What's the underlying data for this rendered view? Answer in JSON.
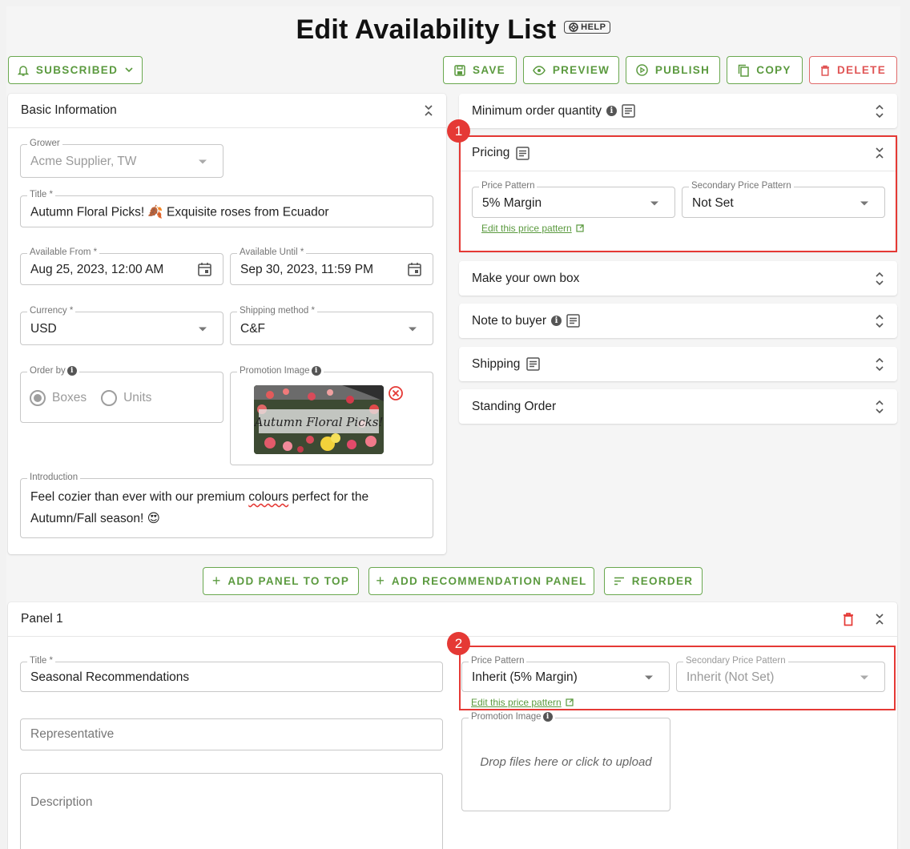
{
  "header": {
    "title": "Edit Availability List",
    "help_label": "HELP"
  },
  "toolbar": {
    "subscribed_label": "SUBSCRIBED",
    "save_label": "SAVE",
    "preview_label": "PREVIEW",
    "publish_label": "PUBLISH",
    "copy_label": "COPY",
    "delete_label": "DELETE"
  },
  "basic_info": {
    "heading": "Basic Information",
    "grower": {
      "label": "Grower",
      "value": "Acme Supplier, TW"
    },
    "title": {
      "label": "Title *",
      "value": "Autumn Floral Picks! 🍂 Exquisite roses from Ecuador"
    },
    "available_from": {
      "label": "Available From *",
      "value": "Aug 25, 2023, 12:00 AM"
    },
    "available_until": {
      "label": "Available Until *",
      "value": "Sep 30, 2023, 11:59 PM"
    },
    "currency": {
      "label": "Currency *",
      "value": "USD"
    },
    "shipping_method": {
      "label": "Shipping method *",
      "value": "C&F"
    },
    "order_by": {
      "label": "Order by",
      "options": [
        "Boxes",
        "Units"
      ],
      "selected": "Boxes"
    },
    "promotion_image": {
      "label": "Promotion Image",
      "image_text": "Autumn Floral Picks!"
    },
    "introduction": {
      "label": "Introduction",
      "line1_pre": "Feel cozier than ever with our premium ",
      "line1_word": "colours",
      "line1_post": " perfect for the",
      "line2": "Autumn/Fall season! 😍"
    }
  },
  "right_panels": {
    "min_order": "Minimum order quantity",
    "pricing": {
      "heading": "Pricing",
      "price_pattern": {
        "label": "Price Pattern",
        "value": "5% Margin"
      },
      "secondary": {
        "label": "Secondary Price Pattern",
        "value": "Not Set"
      },
      "edit_link": "Edit this price pattern"
    },
    "make_box": "Make your own box",
    "note_buyer": "Note to buyer",
    "shipping": "Shipping",
    "standing_order": "Standing Order"
  },
  "annotations": {
    "badge1": "1",
    "badge2": "2"
  },
  "panel_actions": {
    "add_top": "ADD PANEL TO TOP",
    "add_recommendation": "ADD RECOMMENDATION PANEL",
    "reorder": "REORDER"
  },
  "panel1": {
    "heading": "Panel 1",
    "title": {
      "label": "Title *",
      "value": "Seasonal Recommendations"
    },
    "representative_placeholder": "Representative",
    "description_placeholder": "Description",
    "price_pattern": {
      "label": "Price Pattern",
      "value": "Inherit (5% Margin)"
    },
    "secondary": {
      "label": "Secondary Price Pattern",
      "value": "Inherit (Not Set)"
    },
    "edit_link": "Edit this price pattern",
    "promotion_image": {
      "label": "Promotion Image",
      "drop_text": "Drop files here or click to upload"
    }
  },
  "colors": {
    "accent": "#5b9a3f",
    "danger": "#e53935",
    "annotation": "#e53935"
  }
}
